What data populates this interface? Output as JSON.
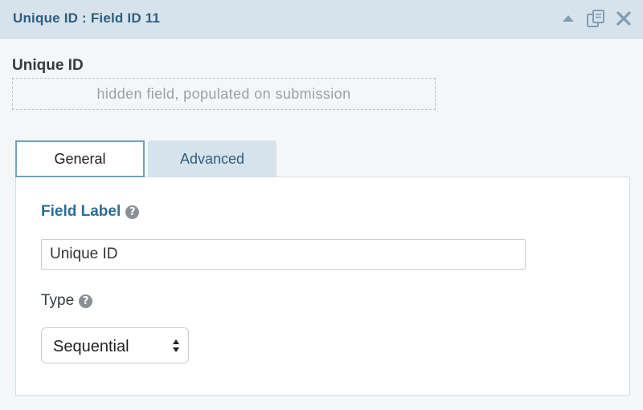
{
  "header": {
    "title": "Unique ID : Field ID 11",
    "icons": [
      "collapse-icon",
      "duplicate-icon",
      "close-icon"
    ]
  },
  "preview": {
    "label": "Unique ID",
    "placeholder_text": "hidden field, populated on submission"
  },
  "tabs": [
    {
      "label": "General",
      "active": true
    },
    {
      "label": "Advanced",
      "active": false
    }
  ],
  "settings": {
    "field_label": {
      "label": "Field Label",
      "help_icon": "?",
      "value": "Unique ID"
    },
    "type": {
      "label": "Type",
      "help_icon": "?",
      "selected": "Sequential"
    }
  },
  "colors": {
    "header_bg": "#d7e3ec",
    "accent": "#2e6d93",
    "tab_active_border": "#6fa3c4"
  }
}
